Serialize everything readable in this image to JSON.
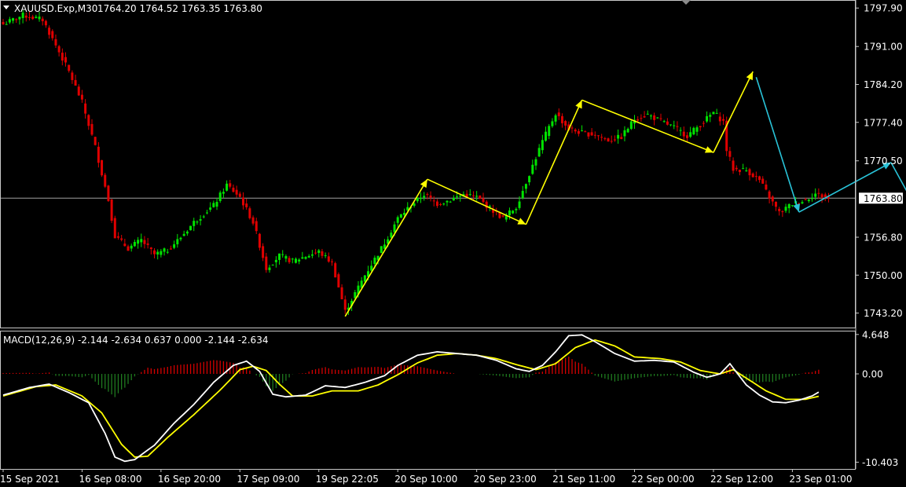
{
  "header": {
    "symbol": "XAUUSD.Exp,M30",
    "ohlc": "1764.20 1764.52 1763.35 1763.80"
  },
  "current_price_label": "1763.80",
  "colors": {
    "background": "#000000",
    "bull_candle": "#00e400",
    "bear_candle": "#e00000",
    "arrow_yellow": "#ffff00",
    "arrow_cyan": "#29c3d8",
    "macd_line": "#ffffff",
    "signal_line": "#ffff00",
    "hist_pos": "#d40000",
    "hist_neg": "#1f7a1f",
    "grid_line": "#c0c0c0"
  },
  "chart_data": [
    {
      "type": "candlestick",
      "title": "XAUUSD.Exp,M30",
      "ylim": [
        1740.6,
        1799.2
      ],
      "y_ticks": [
        "1797.90",
        "1791.00",
        "1784.20",
        "1777.40",
        "1770.50",
        "1763.80",
        "1756.80",
        "1750.00",
        "1743.20"
      ],
      "x_ticks": [
        "15 Sep 2021",
        "16 Sep 08:00",
        "16 Sep 20:00",
        "17 Sep 09:00",
        "19 Sep 22:05",
        "20 Sep 10:00",
        "20 Sep 23:00",
        "21 Sep 11:00",
        "22 Sep 00:00",
        "22 Sep 12:00",
        "23 Sep 01:00"
      ],
      "x_tick_index": [
        0,
        24,
        48,
        72,
        96,
        120,
        144,
        168,
        192,
        216,
        240
      ],
      "bar_count": 252,
      "current_price": 1763.8,
      "close_anchors": [
        [
          0,
          1795.0
        ],
        [
          6,
          1796.6
        ],
        [
          12,
          1795.8
        ],
        [
          16,
          1791.2
        ],
        [
          20,
          1786.5
        ],
        [
          24,
          1781.0
        ],
        [
          28,
          1773.0
        ],
        [
          32,
          1763.5
        ],
        [
          34,
          1757.0
        ],
        [
          38,
          1754.8
        ],
        [
          42,
          1756.3
        ],
        [
          46,
          1753.7
        ],
        [
          50,
          1754.5
        ],
        [
          54,
          1756.8
        ],
        [
          58,
          1759.5
        ],
        [
          64,
          1762.5
        ],
        [
          68,
          1766.2
        ],
        [
          72,
          1764.0
        ],
        [
          76,
          1759.5
        ],
        [
          80,
          1751.2
        ],
        [
          84,
          1753.5
        ],
        [
          88,
          1752.5
        ],
        [
          92,
          1753.4
        ],
        [
          96,
          1754.2
        ],
        [
          100,
          1752.2
        ],
        [
          104,
          1743.5
        ],
        [
          110,
          1750.0
        ],
        [
          116,
          1755.8
        ],
        [
          120,
          1760.2
        ],
        [
          124,
          1762.5
        ],
        [
          128,
          1764.5
        ],
        [
          132,
          1762.8
        ],
        [
          136,
          1763.5
        ],
        [
          140,
          1764.5
        ],
        [
          144,
          1764.0
        ],
        [
          148,
          1762.0
        ],
        [
          152,
          1760.2
        ],
        [
          156,
          1762.2
        ],
        [
          160,
          1768.2
        ],
        [
          164,
          1774.0
        ],
        [
          168,
          1779.0
        ],
        [
          172,
          1776.2
        ],
        [
          176,
          1775.5
        ],
        [
          180,
          1775.2
        ],
        [
          184,
          1774.2
        ],
        [
          188,
          1774.8
        ],
        [
          192,
          1778.0
        ],
        [
          196,
          1778.8
        ],
        [
          200,
          1777.6
        ],
        [
          204,
          1776.5
        ],
        [
          208,
          1775.0
        ],
        [
          212,
          1777.0
        ],
        [
          216,
          1779.2
        ],
        [
          219,
          1777.5
        ],
        [
          220,
          1772.5
        ],
        [
          222,
          1769.0
        ],
        [
          226,
          1768.8
        ],
        [
          230,
          1767.0
        ],
        [
          234,
          1763.0
        ],
        [
          236,
          1761.2
        ],
        [
          240,
          1762.8
        ],
        [
          244,
          1763.5
        ],
        [
          247,
          1764.6
        ],
        [
          251,
          1763.8
        ]
      ],
      "arrows": [
        {
          "color": "yellow",
          "points": [
            [
              1742.6,
              104
            ],
            [
              1767.2,
              129
            ]
          ]
        },
        {
          "color": "yellow",
          "points": [
            [
              1767.2,
              129
            ],
            [
              1759.1,
              159
            ]
          ]
        },
        {
          "color": "yellow",
          "points": [
            [
              1759.1,
              159
            ],
            [
              1781.4,
              176
            ]
          ]
        },
        {
          "color": "yellow",
          "points": [
            [
              1781.4,
              176
            ],
            [
              1772.0,
              216
            ]
          ]
        },
        {
          "color": "yellow",
          "points": [
            [
              1772.0,
              216
            ],
            [
              1786.5,
              228
            ]
          ]
        },
        {
          "color": "cyan",
          "points": [
            [
              1785.5,
              229
            ],
            [
              1761.3,
              242
            ]
          ]
        },
        {
          "color": "cyan",
          "points": [
            [
              1761.3,
              242
            ],
            [
              1770.2,
              270
            ]
          ]
        },
        {
          "color": "cyan",
          "points": [
            [
              1770.2,
              270
            ],
            [
              1753.0,
              286
            ]
          ]
        }
      ]
    },
    {
      "type": "macd",
      "title": "MACD(12,26,9) -2.144 -2.634 0.637 0.000 -2.144 -2.634",
      "ylim": [
        -11.2,
        5.0
      ],
      "y_ticks": [
        "4.648",
        "0.00",
        "-10.403"
      ],
      "macd_anchors": [
        [
          0,
          -2.5
        ],
        [
          8,
          -1.6
        ],
        [
          14,
          -1.2
        ],
        [
          20,
          -2.2
        ],
        [
          26,
          -3.4
        ],
        [
          31,
          -7.0
        ],
        [
          34,
          -9.8
        ],
        [
          37,
          -10.3
        ],
        [
          40,
          -10.1
        ],
        [
          46,
          -8.4
        ],
        [
          52,
          -5.8
        ],
        [
          58,
          -3.6
        ],
        [
          64,
          -1.0
        ],
        [
          70,
          1.0
        ],
        [
          74,
          1.5
        ],
        [
          78,
          0.3
        ],
        [
          82,
          -2.4
        ],
        [
          86,
          -2.7
        ],
        [
          92,
          -2.5
        ],
        [
          98,
          -1.4
        ],
        [
          104,
          -1.6
        ],
        [
          110,
          -1.0
        ],
        [
          116,
          -0.2
        ],
        [
          120,
          1.0
        ],
        [
          126,
          2.2
        ],
        [
          132,
          2.6
        ],
        [
          138,
          2.4
        ],
        [
          144,
          2.2
        ],
        [
          150,
          1.6
        ],
        [
          156,
          0.6
        ],
        [
          160,
          0.3
        ],
        [
          164,
          1.0
        ],
        [
          168,
          2.6
        ],
        [
          172,
          4.5
        ],
        [
          176,
          4.6
        ],
        [
          180,
          3.8
        ],
        [
          186,
          2.4
        ],
        [
          192,
          1.5
        ],
        [
          198,
          1.6
        ],
        [
          204,
          1.4
        ],
        [
          210,
          0.2
        ],
        [
          214,
          -0.4
        ],
        [
          218,
          0.0
        ],
        [
          221,
          1.2
        ],
        [
          223,
          0.2
        ],
        [
          226,
          -1.3
        ],
        [
          230,
          -2.5
        ],
        [
          234,
          -3.3
        ],
        [
          238,
          -3.4
        ],
        [
          242,
          -3.1
        ],
        [
          246,
          -2.6
        ],
        [
          248,
          -2.144
        ]
      ],
      "signal_anchors": [
        [
          0,
          -2.6
        ],
        [
          10,
          -1.5
        ],
        [
          16,
          -1.3
        ],
        [
          24,
          -2.6
        ],
        [
          30,
          -4.6
        ],
        [
          36,
          -8.3
        ],
        [
          40,
          -9.8
        ],
        [
          44,
          -9.7
        ],
        [
          50,
          -7.5
        ],
        [
          58,
          -4.8
        ],
        [
          66,
          -1.9
        ],
        [
          72,
          0.5
        ],
        [
          76,
          0.9
        ],
        [
          80,
          0.4
        ],
        [
          84,
          -1.2
        ],
        [
          88,
          -2.6
        ],
        [
          94,
          -2.6
        ],
        [
          100,
          -2.0
        ],
        [
          108,
          -2.0
        ],
        [
          114,
          -1.3
        ],
        [
          120,
          -0.1
        ],
        [
          126,
          1.3
        ],
        [
          132,
          2.2
        ],
        [
          138,
          2.4
        ],
        [
          144,
          2.2
        ],
        [
          150,
          1.8
        ],
        [
          156,
          1.1
        ],
        [
          162,
          0.5
        ],
        [
          168,
          1.2
        ],
        [
          174,
          3.1
        ],
        [
          180,
          4.0
        ],
        [
          186,
          3.3
        ],
        [
          192,
          2.0
        ],
        [
          200,
          1.8
        ],
        [
          206,
          1.4
        ],
        [
          212,
          0.4
        ],
        [
          218,
          0.0
        ],
        [
          222,
          0.5
        ],
        [
          226,
          -0.5
        ],
        [
          232,
          -2.0
        ],
        [
          238,
          -3.0
        ],
        [
          244,
          -3.0
        ],
        [
          248,
          -2.634
        ]
      ]
    }
  ]
}
